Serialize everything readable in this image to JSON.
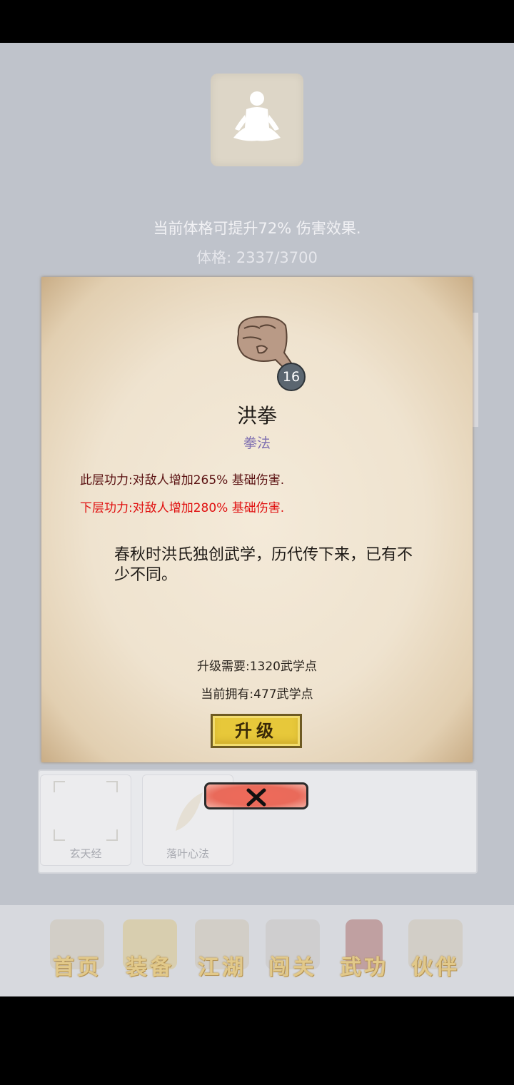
{
  "attribute": {
    "effect_text": "当前体格可提升72% 伤害效果.",
    "label": "体格:",
    "value": "2337/3700"
  },
  "skill": {
    "level": "16",
    "name": "洪拳",
    "type": "拳法",
    "current_effect": "此层功力:对敌人增加265% 基础伤害.",
    "next_effect": "下层功力:对敌人增加280% 基础伤害.",
    "description": "春秋时洪氏独创武学，历代传下来，已有不少不同。",
    "upgrade_cost": "升级需要:1320武学点",
    "current_points": "当前拥有:477武学点",
    "upgrade_label": "升级"
  },
  "skill_slots": [
    {
      "label": "玄天经"
    },
    {
      "label": "落叶心法"
    }
  ],
  "nav": [
    {
      "label": "首页",
      "icon": "temple-icon"
    },
    {
      "label": "装备",
      "icon": "armor-icon"
    },
    {
      "label": "江湖",
      "icon": "scroll-map-icon"
    },
    {
      "label": "闯关",
      "icon": "swords-icon"
    },
    {
      "label": "武功",
      "icon": "book-icon"
    },
    {
      "label": "伙伴",
      "icon": "companions-icon"
    }
  ],
  "colors": {
    "current_effect": "#5b1212",
    "next_effect": "#e01010",
    "skill_type": "#7f6fb0",
    "upgrade_button": "#e7c83a",
    "close_button": "#e96a5a"
  }
}
